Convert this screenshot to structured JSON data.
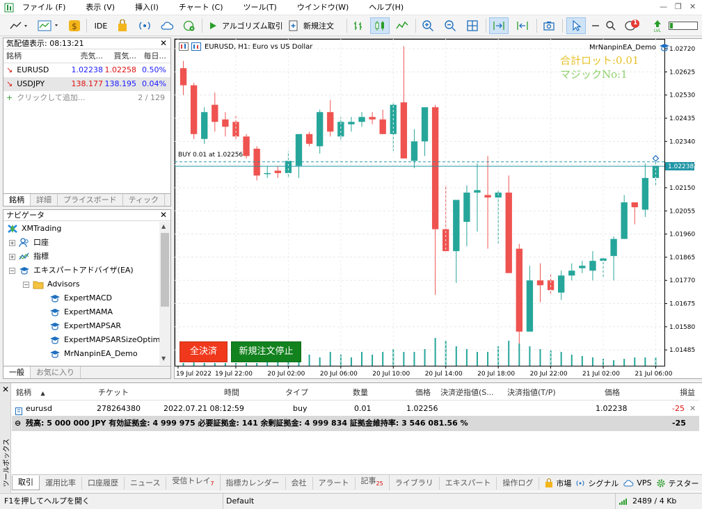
{
  "menu": {
    "items": [
      "ファイル (F)",
      "表示 (V)",
      "挿入(I)",
      "チャート (C)",
      "ツール(T)",
      "ウインドウ(W)",
      "ヘルプ(H)"
    ]
  },
  "toolbar": {
    "ide_label": "IDE",
    "algo_label": "アルゴリズム取引",
    "new_order_label": "新規注文",
    "notification_count": "1"
  },
  "market_watch": {
    "title": "気配値表示: 08:13:21",
    "columns": [
      "銘柄",
      "売気...",
      "買気...",
      "毎日..."
    ],
    "rows": [
      {
        "symbol": "EURUSD",
        "bid": "1.02238",
        "ask": "1.02258",
        "daily": "0.50%"
      },
      {
        "symbol": "USDJPY",
        "bid": "138.177",
        "ask": "138.195",
        "daily": "0.04%"
      }
    ],
    "add_label": "クリックして追加...",
    "count": "2 / 129",
    "tabs": [
      "銘柄",
      "詳細",
      "プライスボード",
      "ティック"
    ]
  },
  "navigator": {
    "title": "ナビゲータ",
    "root": "XMTrading",
    "items": [
      "口座",
      "指標",
      "エキスパートアドバイザ(EA)"
    ],
    "folder": "Advisors",
    "experts": [
      "ExpertMACD",
      "ExpertMAMA",
      "ExpertMAPSAR",
      "ExpertMAPSARSizeOptim",
      "MrNanpinEA_Demo"
    ],
    "tabs": [
      "一般",
      "お気に入り"
    ]
  },
  "chart": {
    "title": "EURUSD, H1:  Euro vs US Dollar",
    "ea_name": "MrNanpinEA_Demo",
    "overlay_lot": "合計ロット:0.01",
    "overlay_magic": "マジックNo:1",
    "buy_label": "BUY 0.01 at 1.02256",
    "current_price_label": "1.02238",
    "btn_close_all": "全決済",
    "btn_stop_orders": "新規注文停止"
  },
  "chart_data": {
    "type": "candlestick",
    "title": "EURUSD, H1:  Euro vs US Dollar",
    "y_ticks": [
      "1.02720",
      "1.02625",
      "1.02530",
      "1.02435",
      "1.02340",
      "1.02245",
      "1.02150",
      "1.02055",
      "1.01960",
      "1.01865",
      "1.01770",
      "1.01675",
      "1.01580",
      "1.01485"
    ],
    "ylim": [
      1.0142,
      1.0276
    ],
    "x_ticks": [
      "19 Jul 2022",
      "19 Jul 22:00",
      "20 Jul 02:00",
      "20 Jul 06:00",
      "20 Jul 10:00",
      "20 Jul 14:00",
      "20 Jul 18:00",
      "20 Jul 22:00",
      "21 Jul 02:00",
      "21 Jul 06:00"
    ],
    "current_price": 1.02238,
    "buy_price": 1.02256,
    "candles": [
      [
        1.0264,
        1.0267,
        1.0253,
        1.0257
      ],
      [
        1.0257,
        1.0258,
        1.0235,
        1.0237
      ],
      [
        1.0235,
        1.0248,
        1.0233,
        1.0246
      ],
      [
        1.0249,
        1.0254,
        1.0238,
        1.0242
      ],
      [
        1.0243,
        1.0246,
        1.0236,
        1.024
      ],
      [
        1.0242,
        1.0245,
        1.0234,
        1.0236
      ],
      [
        1.0236,
        1.0237,
        1.0227,
        1.0228
      ],
      [
        1.0231,
        1.0232,
        1.0218,
        1.022
      ],
      [
        1.0221,
        1.0224,
        1.0219,
        1.0221
      ],
      [
        1.0222,
        1.0224,
        1.0219,
        1.0221
      ],
      [
        1.0221,
        1.023,
        1.0219,
        1.0226
      ],
      [
        1.0224,
        1.0236,
        1.0219,
        1.0237
      ],
      [
        1.0237,
        1.0238,
        1.0232,
        1.0233
      ],
      [
        1.0232,
        1.0247,
        1.0229,
        1.0246
      ],
      [
        1.0246,
        1.0251,
        1.0236,
        1.0238
      ],
      [
        1.0236,
        1.0244,
        1.0234,
        1.0242
      ],
      [
        1.0241,
        1.0244,
        1.0238,
        1.0242
      ],
      [
        1.0242,
        1.0246,
        1.024,
        1.0244
      ],
      [
        1.0244,
        1.0246,
        1.0241,
        1.0243
      ],
      [
        1.0243,
        1.0247,
        1.0237,
        1.0237
      ],
      [
        1.0237,
        1.025,
        1.023,
        1.0249
      ],
      [
        1.025,
        1.0273,
        1.0229,
        1.0227
      ],
      [
        1.0226,
        1.0239,
        1.0223,
        1.0234
      ],
      [
        1.0234,
        1.0247,
        1.0228,
        1.0248
      ],
      [
        1.0248,
        1.0249,
        1.0171,
        1.0198
      ],
      [
        1.0198,
        1.0216,
        1.0189,
        1.0189
      ],
      [
        1.0189,
        1.0209,
        1.0176,
        1.021
      ],
      [
        1.0201,
        1.0216,
        1.0191,
        1.0213
      ],
      [
        1.0213,
        1.0225,
        1.0197,
        1.0214
      ],
      [
        1.0212,
        1.0228,
        1.019,
        1.0211
      ],
      [
        1.0211,
        1.0214,
        1.0192,
        1.0213
      ],
      [
        1.0213,
        1.022,
        1.0183,
        1.018
      ],
      [
        1.019,
        1.0192,
        1.0151,
        1.0156
      ],
      [
        1.0156,
        1.0183,
        1.0159,
        1.0177
      ],
      [
        1.0177,
        1.0184,
        1.0168,
        1.0175
      ],
      [
        1.0177,
        1.018,
        1.0171,
        1.0173
      ],
      [
        1.0172,
        1.0181,
        1.0169,
        1.0179
      ],
      [
        1.0179,
        1.0184,
        1.0177,
        1.0181
      ],
      [
        1.0182,
        1.0185,
        1.018,
        1.0183
      ],
      [
        1.0181,
        1.0189,
        1.0177,
        1.0185
      ],
      [
        1.0185,
        1.0187,
        1.0178,
        1.0186
      ],
      [
        1.0187,
        1.0195,
        1.0177,
        1.0194
      ],
      [
        1.0194,
        1.0212,
        1.0194,
        1.0209
      ],
      [
        1.0209,
        1.0208,
        1.02,
        1.0207
      ],
      [
        1.0206,
        1.0225,
        1.0203,
        1.0219
      ],
      [
        1.0219,
        1.0227,
        1.0216,
        1.0224
      ]
    ],
    "volume_relative": [
      0.1,
      0.12,
      0.1,
      0.1,
      0.1,
      0.1,
      0.1,
      0.1,
      0.15,
      0.25,
      0.2,
      0.3,
      0.4,
      0.3,
      0.5,
      0.4,
      0.3,
      0.5,
      0.4,
      0.5,
      0.6,
      0.5,
      0.5,
      0.6,
      1.0,
      0.9,
      0.7,
      0.6,
      0.5,
      0.5,
      0.7,
      0.9,
      0.8,
      0.7,
      0.6,
      0.55,
      0.5,
      0.4,
      0.35,
      0.3,
      0.25,
      0.2,
      0.25,
      0.3,
      0.3,
      0.3
    ],
    "up_color": "#26a69a",
    "down_color": "#ef5350"
  },
  "toolbox": {
    "side_label": "ツールボックス",
    "columns": [
      "銘柄",
      "チケット",
      "時間",
      "タイプ",
      "数量",
      "価格",
      "決済逆指値(S...",
      "決済指値(T/P)",
      "価格",
      "損益"
    ],
    "position": {
      "symbol": "eurusd",
      "ticket": "278264380",
      "time": "2022.07.21 08:12:59",
      "type": "buy",
      "volume": "0.01",
      "price": "1.02256",
      "sl": "",
      "tp": "",
      "current": "1.02238",
      "profit": "-25"
    },
    "summary": "残高: 5 000 000 JPY  有効証拠金: 4 999 975  必要証拠金: 141  余剰証拠金: 4 999 834  証拠金維持率: 3 546 081.56 %",
    "summary_profit": "-25",
    "tabs": [
      {
        "label": "取引",
        "badge": ""
      },
      {
        "label": "運用比率",
        "badge": ""
      },
      {
        "label": "口座履歴",
        "badge": ""
      },
      {
        "label": "ニュース",
        "badge": ""
      },
      {
        "label": "受信トレイ",
        "badge": "7"
      },
      {
        "label": "指標カレンダー",
        "badge": ""
      },
      {
        "label": "会社",
        "badge": ""
      },
      {
        "label": "アラート",
        "badge": ""
      },
      {
        "label": "記事",
        "badge": "25"
      },
      {
        "label": "ライブラリ",
        "badge": ""
      },
      {
        "label": "エキスパート",
        "badge": ""
      },
      {
        "label": "操作ログ",
        "badge": ""
      }
    ],
    "right_links": [
      "市場",
      "シグナル",
      "VPS",
      "テスター"
    ]
  },
  "status": {
    "help": "F1を押してヘルプを開く",
    "profile": "Default",
    "traffic": "2489 / 4 Kb"
  },
  "colors": {
    "bid_blue": "#1a1aff",
    "ask_red": "#e01010",
    "lot_overlay": "#e6c229",
    "magic_overlay": "#8fd16e",
    "price_line": "#2196a6"
  }
}
